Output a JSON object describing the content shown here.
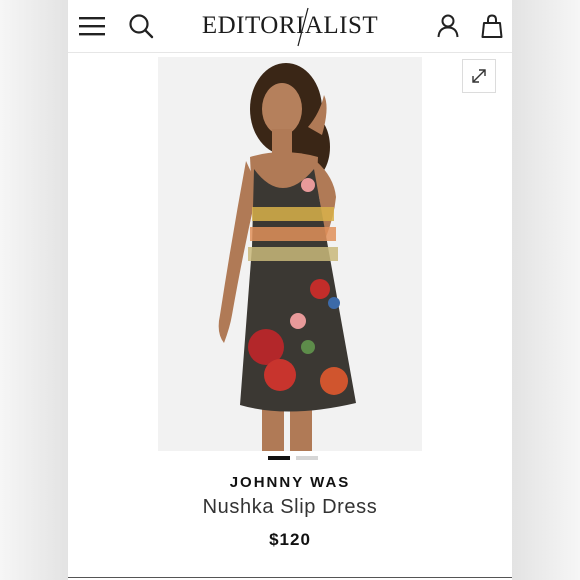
{
  "header": {
    "logo_text": "EDITORIALIST",
    "icons": [
      "menu-icon",
      "search-icon",
      "account-icon",
      "bag-icon"
    ]
  },
  "product": {
    "brand": "JOHNNY WAS",
    "name": "Nushka Slip Dress",
    "price": "$120",
    "image_description": "Model wearing a dark floral printed slip dress with nesting doll motif"
  },
  "gallery": {
    "total_images": 2,
    "active_index": 0
  },
  "colors": {
    "background": "#ffffff",
    "text": "#111111",
    "dot_active": "#111111",
    "dot_inactive": "#d6d6d6"
  }
}
